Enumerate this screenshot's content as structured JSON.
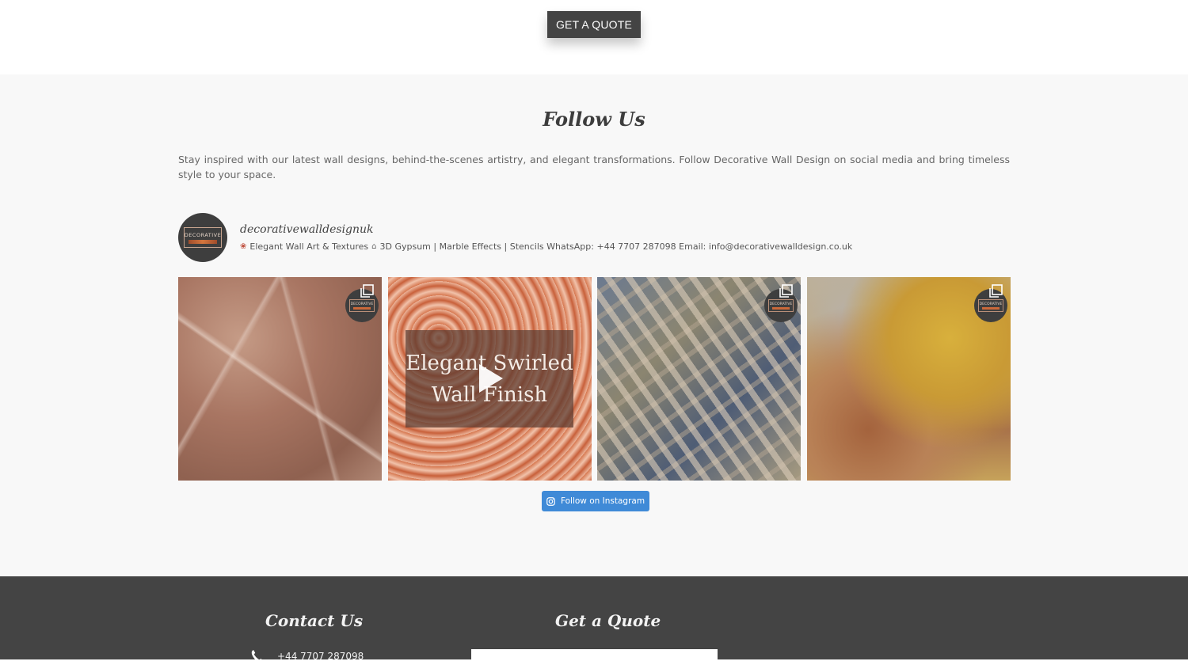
{
  "top": {
    "quote_button": "GET A QUOTE"
  },
  "follow": {
    "title": "Follow Us",
    "description": "Stay inspired with our latest wall designs, behind-the-scenes artistry, and elegant transformations. Follow Decorative Wall Design on social media and bring timeless style to your space."
  },
  "profile": {
    "username": "decorativewalldesignuk",
    "avatar_text": "DECORATIVE",
    "bio_part1": "Elegant Wall Art & Textures",
    "bio_part2": "3D Gypsum | Marble Effects | Stencils WhatsApp: +44 7707 287098 Email: info@decorativewalldesign.co.uk",
    "bio_icons": [
      "palette-icon",
      "classical-building-icon"
    ]
  },
  "posts": [
    {
      "type": "carousel",
      "badge_text": "DECORATIVE"
    },
    {
      "type": "video",
      "overlay_text_line1": "Elegant Swirled",
      "overlay_text_line2": "Wall Finish"
    },
    {
      "type": "carousel",
      "badge_text": "DECORATIVE"
    },
    {
      "type": "carousel",
      "badge_text": "DECORATIVE"
    }
  ],
  "instagram_button": {
    "label": "Follow on Instagram",
    "icon": "instagram-icon",
    "color": "#3f8ad7"
  },
  "footer": {
    "contact_heading": "Contact Us",
    "quote_heading": "Get a Quote",
    "phone": "+44 7707 287098",
    "phone_icon": "phone-icon"
  },
  "colors": {
    "dark": "#444444",
    "section_bg": "#f8f8f8",
    "accent": "#3f8ad7"
  }
}
